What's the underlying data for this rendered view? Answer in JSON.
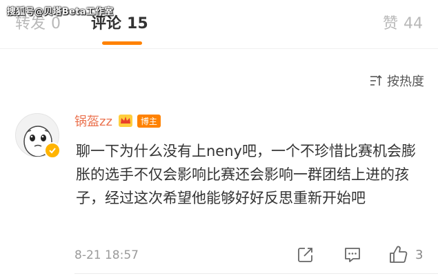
{
  "watermark": "搜狐号@贝塔Beta工作室",
  "tabs": {
    "repost": {
      "label": "转发",
      "count": "0"
    },
    "comment": {
      "label": "评论",
      "count": "15"
    },
    "like": {
      "label": "赞",
      "count": "44"
    }
  },
  "sort": {
    "label": "按热度",
    "icon": "sort-icon"
  },
  "comment": {
    "username": "锅盔zz",
    "badge": "博主",
    "text": "聊一下为什么没有上neny吧，一个不珍惜比赛机会膨胀的选手不仅会影响比赛还会影响一群团结上进的孩子，经过这次希望他能够好好反思重新开始吧",
    "time": "8-21 18:57",
    "like_count": "3"
  },
  "colors": {
    "accent": "#ff8200",
    "username": "#eb7350",
    "muted": "#b8b8b8"
  }
}
